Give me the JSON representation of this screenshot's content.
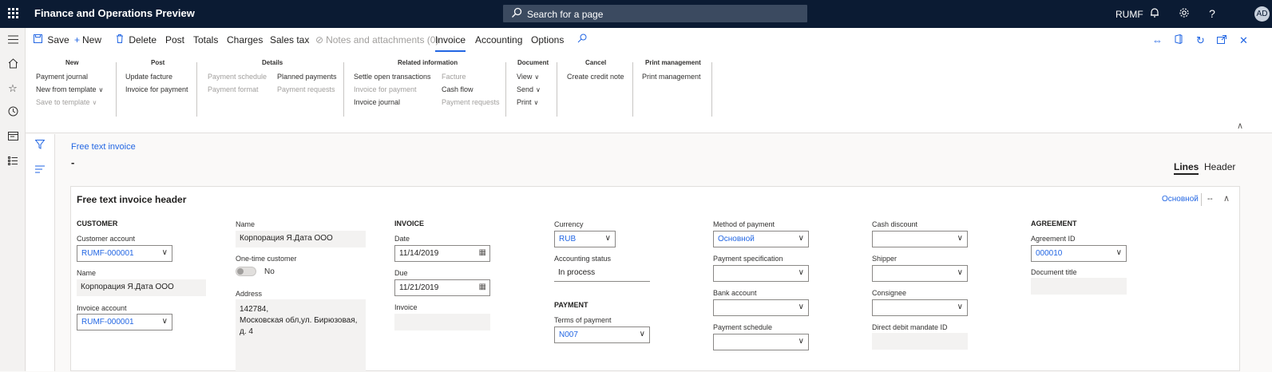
{
  "topbar": {
    "app_title": "Finance and Operations Preview",
    "search_placeholder": "Search for a page",
    "company": "RUMF",
    "avatar_initials": "AD"
  },
  "actionbar": {
    "save": "Save",
    "new": "New",
    "delete": "Delete",
    "post": "Post",
    "totals": "Totals",
    "charges": "Charges",
    "sales_tax": "Sales tax",
    "notes": "Notes and attachments (0)",
    "tabs": [
      "Invoice",
      "Accounting",
      "Options"
    ]
  },
  "ribbon": {
    "new": {
      "title": "New",
      "items": [
        "Payment journal",
        "New from template",
        "Save to template"
      ]
    },
    "post": {
      "title": "Post",
      "items": [
        "Update facture",
        "Invoice for payment"
      ]
    },
    "details": {
      "title": "Details",
      "items": [
        "Payment schedule",
        "Payment format",
        "Planned payments",
        "Payment requests"
      ]
    },
    "related": {
      "title": "Related information",
      "items": [
        "Settle open transactions",
        "Invoice for payment",
        "Invoice journal",
        "Facture",
        "Cash flow",
        "Payment requests"
      ]
    },
    "document": {
      "title": "Document",
      "items": [
        "View",
        "Send",
        "Print"
      ]
    },
    "cancel": {
      "title": "Cancel",
      "items": [
        "Create credit note"
      ]
    },
    "print_mgmt": {
      "title": "Print management",
      "items": [
        "Print management"
      ]
    }
  },
  "page": {
    "breadcrumb": "Free text invoice",
    "title": "-",
    "view_lines": "Lines",
    "view_header": "Header"
  },
  "card": {
    "title": "Free text invoice header",
    "summary": "Основной",
    "more": "--"
  },
  "customer": {
    "section": "CUSTOMER",
    "account_label": "Customer account",
    "account_value": "RUMF-000001",
    "name_label": "Name",
    "name_value": "Корпорация Я.Дата ООО",
    "invoice_account_label": "Invoice account",
    "invoice_account_value": "RUMF-000001"
  },
  "customer2": {
    "name_label": "Name",
    "name_value": "Корпорация Я.Дата ООО",
    "onetime_label": "One-time customer",
    "onetime_value": "No",
    "address_label": "Address",
    "address_lines": [
      "142784,",
      "Московская обл,ул. Бирюзовая,",
      "д. 4"
    ]
  },
  "invoice": {
    "section": "INVOICE",
    "date_label": "Date",
    "date_value": "11/14/2019",
    "due_label": "Due",
    "due_value": "11/21/2019",
    "invoice_label": "Invoice",
    "invoice_value": ""
  },
  "currency": {
    "label": "Currency",
    "value": "RUB",
    "status_label": "Accounting status",
    "status_value": "In process",
    "payment_section": "PAYMENT",
    "terms_label": "Terms of payment",
    "terms_value": "N007"
  },
  "payment": {
    "method_label": "Method of payment",
    "method_value": "Основной",
    "spec_label": "Payment specification",
    "bank_label": "Bank account",
    "schedule_label": "Payment schedule"
  },
  "delivery": {
    "cash_discount_label": "Cash discount",
    "shipper_label": "Shipper",
    "consignee_label": "Consignee",
    "ddm_label": "Direct debit mandate ID"
  },
  "agreement": {
    "section": "AGREEMENT",
    "id_label": "Agreement ID",
    "id_value": "000010",
    "doc_title_label": "Document title"
  }
}
